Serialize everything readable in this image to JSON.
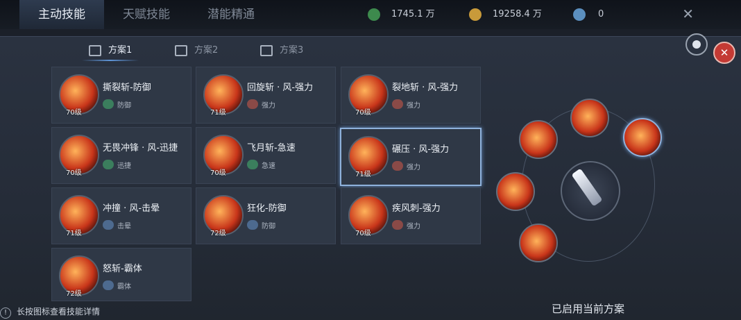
{
  "top_tabs": [
    {
      "label": "主动技能",
      "active": true
    },
    {
      "label": "天赋技能",
      "active": false
    },
    {
      "label": "潜能精通",
      "active": false
    }
  ],
  "resources": [
    {
      "icon": "herb-icon",
      "value": "1745.1 万"
    },
    {
      "icon": "coin-icon",
      "value": "19258.4 万"
    },
    {
      "icon": "gem-icon",
      "value": "0"
    }
  ],
  "top_close": "✕",
  "plans": [
    {
      "label": "方案1",
      "active": true
    },
    {
      "label": "方案2",
      "active": false
    },
    {
      "label": "方案3",
      "active": false
    }
  ],
  "skills": [
    {
      "name": "撕裂斩-防御",
      "level": "70级",
      "tag": "防御",
      "tag_type": "def"
    },
    {
      "name": "回旋斩 · 风-强力",
      "level": "71级",
      "tag": "强力",
      "tag_type": "str"
    },
    {
      "name": "裂地斩 · 风-强力",
      "level": "70级",
      "tag": "强力",
      "tag_type": "str"
    },
    {
      "name": "无畏冲锋 · 风-迅捷",
      "level": "70级",
      "tag": "迅捷",
      "tag_type": "spd"
    },
    {
      "name": "飞月斩-急速",
      "level": "70级",
      "tag": "急速",
      "tag_type": "spd"
    },
    {
      "name": "碾压 · 风-强力",
      "level": "71级",
      "tag": "强力",
      "tag_type": "str",
      "selected": true
    },
    {
      "name": "冲撞 · 风-击晕",
      "level": "71级",
      "tag": "击晕",
      "tag_type": "stun"
    },
    {
      "name": "狂化-防御",
      "level": "72级",
      "tag": "防御",
      "tag_type": "sa"
    },
    {
      "name": "疾风刺-强力",
      "level": "70级",
      "tag": "强力",
      "tag_type": "str"
    },
    {
      "name": "怒斩-霸体",
      "level": "72级",
      "tag": "霸体",
      "tag_type": "sa"
    }
  ],
  "hint": "长按图标查看技能详情",
  "hint_icon": "!",
  "applied_label": "已启用当前方案",
  "colors": {
    "accent": "#8fb2dc",
    "skill_fire": "#c8351a",
    "panel": "#2a3240"
  }
}
